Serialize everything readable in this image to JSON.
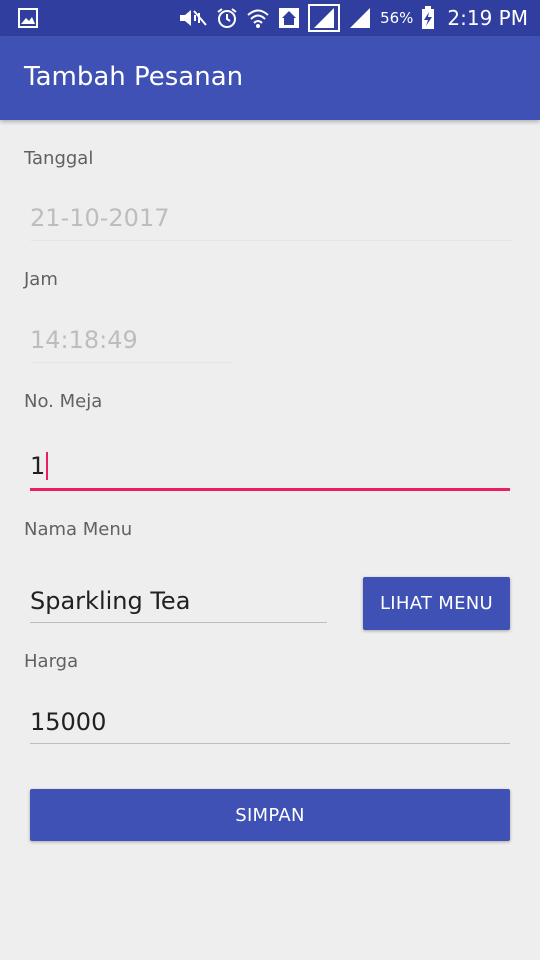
{
  "status_bar": {
    "battery_percent": "56%",
    "time": "2:19 PM",
    "icons": [
      "gallery-icon",
      "mute-icon",
      "alarm-icon",
      "wifi-icon",
      "home-icon",
      "signal-icon",
      "signal-icon",
      "battery-charging-icon"
    ]
  },
  "app_bar": {
    "title": "Tambah Pesanan",
    "color": "#3f51b5"
  },
  "form": {
    "tanggal": {
      "label": "Tanggal",
      "value": "21-10-2017"
    },
    "jam": {
      "label": "Jam",
      "value": "14:18:49"
    },
    "no_meja": {
      "label": "No. Meja",
      "value": "1"
    },
    "nama_menu": {
      "label": "Nama Menu",
      "value": "Sparkling Tea",
      "button_label": "LIHAT MENU"
    },
    "harga": {
      "label": "Harga",
      "value": "15000"
    },
    "submit_label": "SIMPAN"
  },
  "colors": {
    "primary": "#3f51b5",
    "primary_dark": "#303f9f",
    "accent": "#e91e63"
  }
}
